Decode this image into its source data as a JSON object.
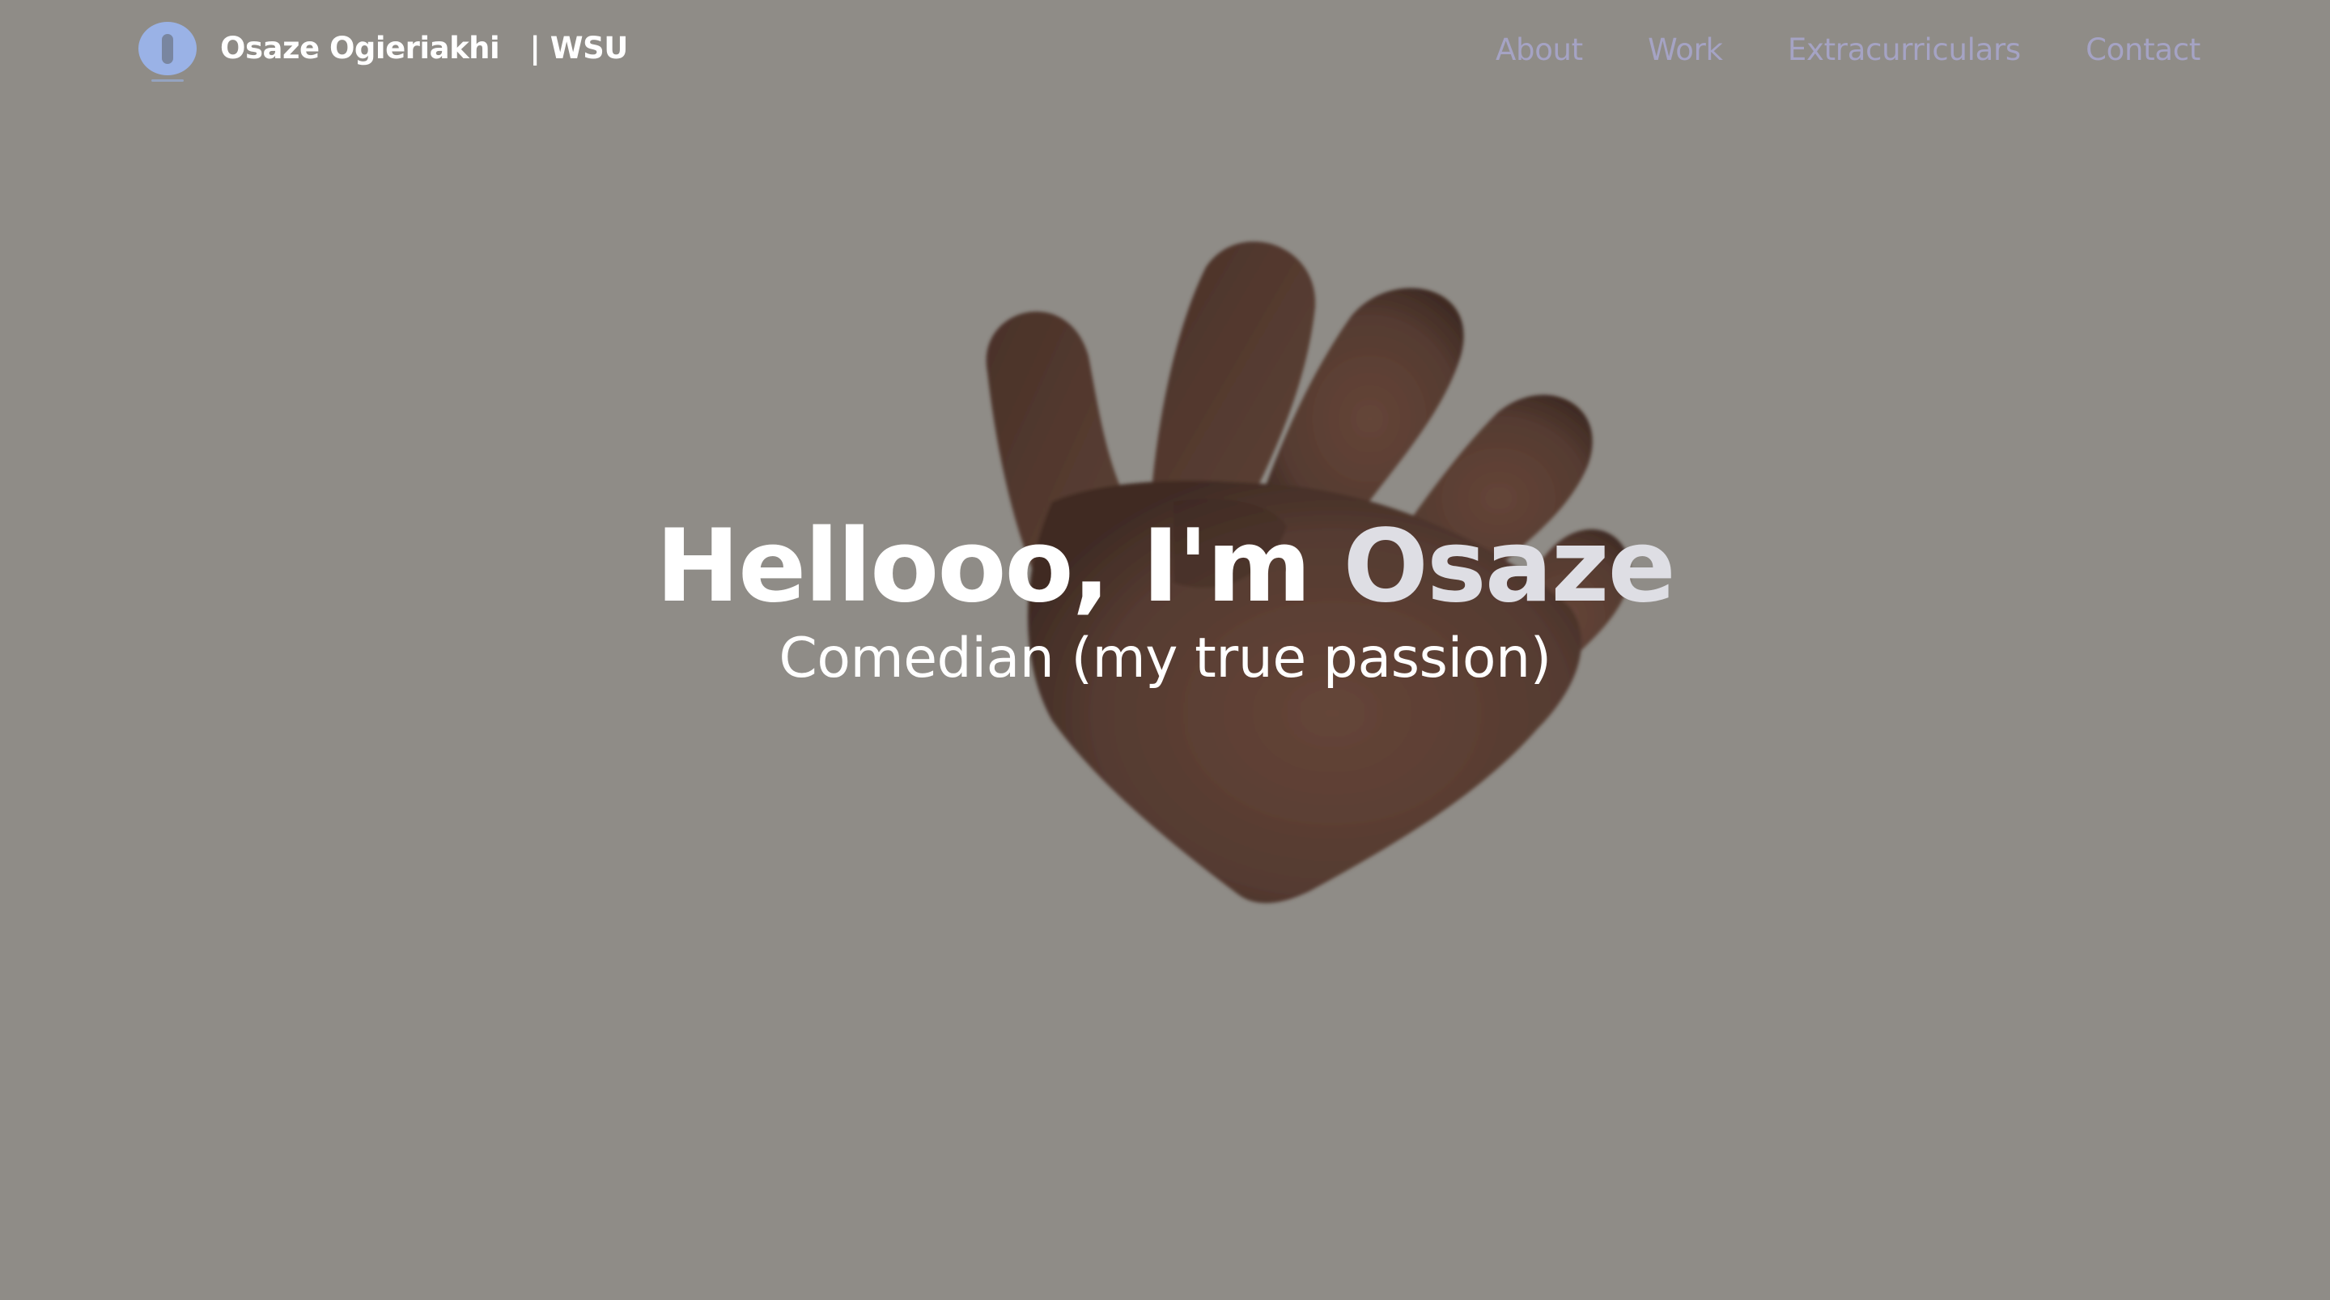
{
  "header": {
    "logo_letter": "O",
    "brand_name": "Osaze Ogieriakhi",
    "brand_suffix": "| WSU"
  },
  "nav": {
    "items": [
      {
        "label": "About"
      },
      {
        "label": "Work"
      },
      {
        "label": "Extracurriculars"
      },
      {
        "label": "Contact"
      }
    ]
  },
  "hero": {
    "title_prefix": "Hellooo, I'm",
    "title_name": "Osaze",
    "subtitle": "Comedian (my true passion)",
    "image": "waving-hand-icon"
  },
  "colors": {
    "background": "#8f8c87",
    "nav_link": "#a5a3c4",
    "logo": "#9ab2e6",
    "name_highlight": "#dedee4",
    "hand": "#5b4036"
  }
}
